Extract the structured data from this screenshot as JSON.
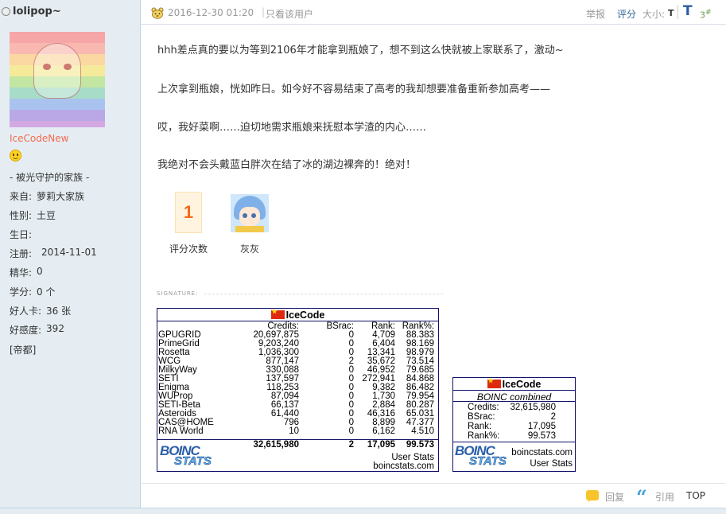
{
  "user": {
    "username": "lolipop~",
    "group_name": "IceCodeNew",
    "title": "- 被光守护的家族 -",
    "info": [
      {
        "label": "来自:",
        "value": "萝莉大家族"
      },
      {
        "label": "性别:",
        "value": "土豆"
      },
      {
        "label": "生日:",
        "value": ""
      },
      {
        "label": "注册:",
        "value": "2014-11-01"
      },
      {
        "label": "精华:",
        "value": "0"
      },
      {
        "label": "学分:",
        "value": "0 个"
      },
      {
        "label": "好人卡:",
        "value": "36 张"
      },
      {
        "label": "好感度:",
        "value": "392"
      }
    ],
    "guild": "[帝都]"
  },
  "post_header": {
    "timestamp": "2016-12-30 01:20",
    "only_author": "只看该用户",
    "report": "举报",
    "rate": "评分",
    "font_size_label": "大小:",
    "font_small": "T",
    "font_big": "T",
    "floor": "3",
    "floor_sup": "#"
  },
  "post_body": {
    "paragraphs": [
      "hhh差点真的要以为等到2106年才能拿到瓶娘了，想不到这么快就被上家联系了，激动~",
      "上次拿到瓶娘，恍如昨日。如今好不容易结束了高考的我却想要准备重新参加高考——",
      "哎，我好菜啊……迫切地需求瓶娘来抚慰本学渣的内心……",
      "我绝对不会头戴蓝白胖次在结了冰的湖边裸奔的！绝对！"
    ]
  },
  "rating": {
    "count": "1",
    "count_label": "评分次数",
    "rater_name": "灰灰"
  },
  "signature_label": "SIGNATURE:",
  "boinc_stats": {
    "user": "IceCode",
    "headers": [
      "Credits:",
      "BSrac:",
      "Rank:",
      "Rank%:"
    ],
    "rows": [
      {
        "project": "GPUGRID",
        "credits": "20,697,875",
        "bsrac": "0",
        "rank": "4,709",
        "rankpct": "88.383"
      },
      {
        "project": "PrimeGrid",
        "credits": "9,203,240",
        "bsrac": "0",
        "rank": "6,404",
        "rankpct": "98.169"
      },
      {
        "project": "Rosetta",
        "credits": "1,036,300",
        "bsrac": "0",
        "rank": "13,341",
        "rankpct": "98.979"
      },
      {
        "project": "WCG",
        "credits": "877,147",
        "bsrac": "2",
        "rank": "35,672",
        "rankpct": "73.514"
      },
      {
        "project": "MilkyWay",
        "credits": "330,088",
        "bsrac": "0",
        "rank": "46,952",
        "rankpct": "79.685"
      },
      {
        "project": "SETI",
        "credits": "137,597",
        "bsrac": "0",
        "rank": "272,941",
        "rankpct": "84.868"
      },
      {
        "project": "Enigma",
        "credits": "118,253",
        "bsrac": "0",
        "rank": "9,382",
        "rankpct": "86.482"
      },
      {
        "project": "WUProp",
        "credits": "87,094",
        "bsrac": "0",
        "rank": "1,730",
        "rankpct": "79.954"
      },
      {
        "project": "SETI-Beta",
        "credits": "66,137",
        "bsrac": "0",
        "rank": "2,884",
        "rankpct": "80.287"
      },
      {
        "project": "Asteroids",
        "credits": "61,440",
        "bsrac": "0",
        "rank": "46,316",
        "rankpct": "65.031"
      },
      {
        "project": "CAS@HOME",
        "credits": "796",
        "bsrac": "0",
        "rank": "8,899",
        "rankpct": "47.377"
      },
      {
        "project": "RNA World",
        "credits": "10",
        "bsrac": "0",
        "rank": "6,162",
        "rankpct": "4.510"
      }
    ],
    "total": {
      "credits": "32,615,980",
      "bsrac": "2",
      "rank": "17,095",
      "rankpct": "99.573"
    },
    "logo_top": "BOINC",
    "logo_bottom": "STATS",
    "user_stats": "User Stats",
    "site": "boincstats.com"
  },
  "boinc_combined": {
    "user": "IceCode",
    "subtitle": "BOINC combined",
    "rows": [
      {
        "label": "Credits:",
        "value": "32,615,980"
      },
      {
        "label": "BSrac:",
        "value": "2"
      },
      {
        "label": "Rank:",
        "value": "17,095"
      },
      {
        "label": "Rank%:",
        "value": "99.573"
      }
    ],
    "site": "boincstats.com",
    "user_stats": "User Stats"
  },
  "footer": {
    "reply": "回复",
    "quote_icon": "“",
    "quote": "引用",
    "top": "TOP"
  }
}
